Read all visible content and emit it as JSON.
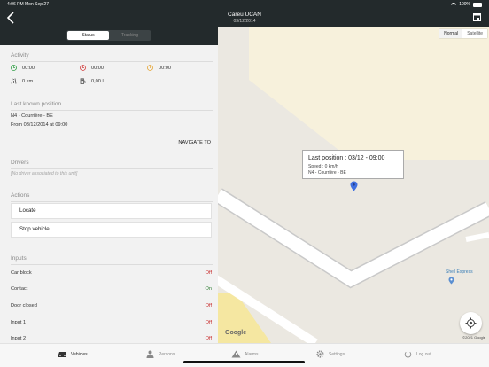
{
  "status_bar": {
    "time": "4:06 PM",
    "date": "Mon Sep 27",
    "battery": "100%"
  },
  "header": {
    "title": "Careu UCAN",
    "subtitle": "03/12/2014",
    "segments": [
      "Status",
      "Tracking"
    ],
    "active_segment": "Status"
  },
  "activity": {
    "heading": "Activity",
    "times": [
      "00:00",
      "00:00",
      "00:00"
    ],
    "distance": "0 km",
    "fuel": "0,00 l"
  },
  "last_position": {
    "heading": "Last known position",
    "address": "N4 - Courrière - BE",
    "since": "From 03/12/2014 at 09:00",
    "navigate_label": "NAVIGATE TO"
  },
  "drivers": {
    "heading": "Drivers",
    "empty": "[No driver associated to this unit]"
  },
  "actions": {
    "heading": "Actions",
    "buttons": [
      "Locate",
      "Stop vehicle"
    ]
  },
  "inputs": {
    "heading": "Inputs",
    "rows": [
      {
        "name": "Car block",
        "state": "Off"
      },
      {
        "name": "Contact",
        "state": "On"
      },
      {
        "name": "Door closed",
        "state": "Off"
      },
      {
        "name": "Input 1",
        "state": "Off"
      },
      {
        "name": "Input 2",
        "state": "Off"
      }
    ]
  },
  "map": {
    "types": [
      "Normal",
      "Satellite"
    ],
    "active_type": "Normal",
    "popup_title": "Last position : 03/12 - 09:00",
    "popup_speed": "Speed : 0 km/h",
    "popup_address": "N4 - Courrière - BE",
    "poi": "Shell Express",
    "attribution": "Google",
    "copyright": "©2021 Google",
    "pin_color": "#3f6fe0"
  },
  "tabbar": {
    "items": [
      "Vehicles",
      "Persons",
      "Alarms",
      "Settings",
      "Log out"
    ],
    "active": "Vehicles"
  },
  "colors": {
    "header": "#232a2c",
    "off": "#c62828",
    "on": "#2e7d32"
  }
}
